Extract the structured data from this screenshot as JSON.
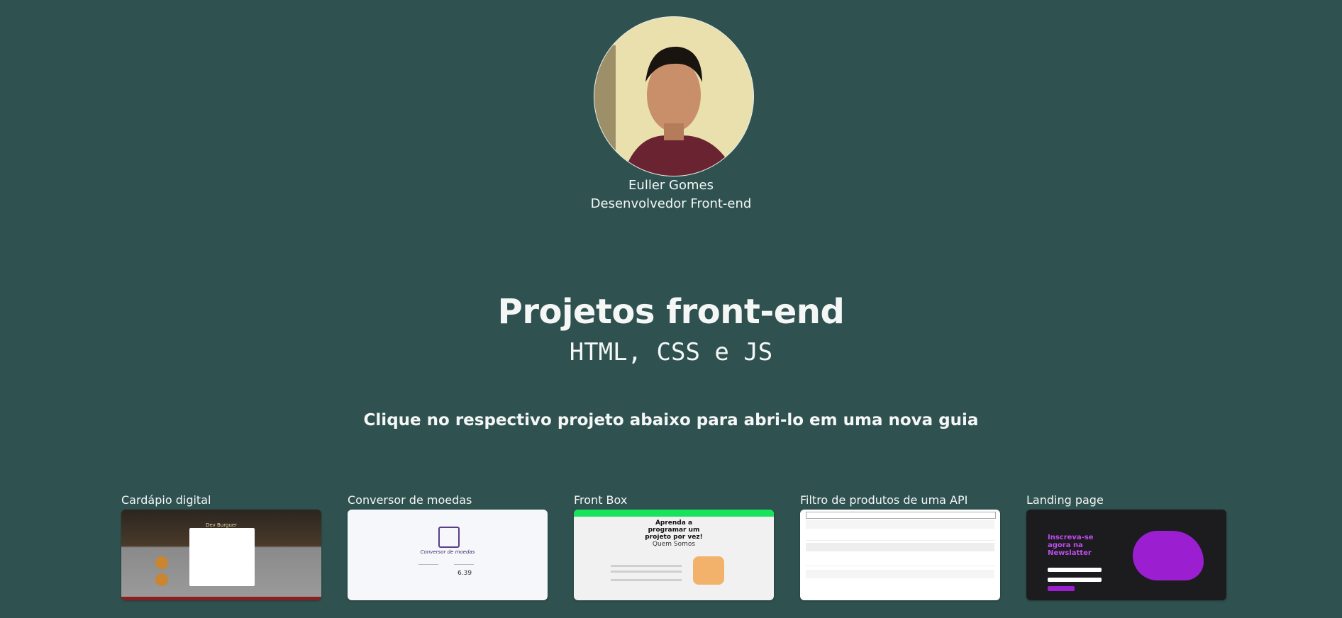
{
  "profile": {
    "name": "Euller Gomes",
    "role": "Desenvolvedor Front-end"
  },
  "header": {
    "title": "Projetos front-end",
    "subtitle": "HTML, CSS e JS"
  },
  "instruction": "Clique no respectivo projeto abaixo para abri-lo em uma nova guia",
  "projects": [
    {
      "title": "Cardápio digital",
      "thumb_text": "Dev Burguer"
    },
    {
      "title": "Conversor de moedas",
      "thumb_text": "Conversor de moedas",
      "thumb_value": "6.39"
    },
    {
      "title": "Front Box",
      "thumb_text": "Aprenda a programar um projeto por vez!",
      "thumb_sub": "Quem Somos"
    },
    {
      "title": "Filtro de produtos de uma API"
    },
    {
      "title": "Landing page",
      "thumb_text": "Inscreva-se agora na Newslatter"
    }
  ],
  "colors": {
    "background": "#2f5250",
    "text": "#f4f7f6",
    "frontbox_accent": "#19e35a",
    "landing_accent": "#9b1fd1"
  }
}
